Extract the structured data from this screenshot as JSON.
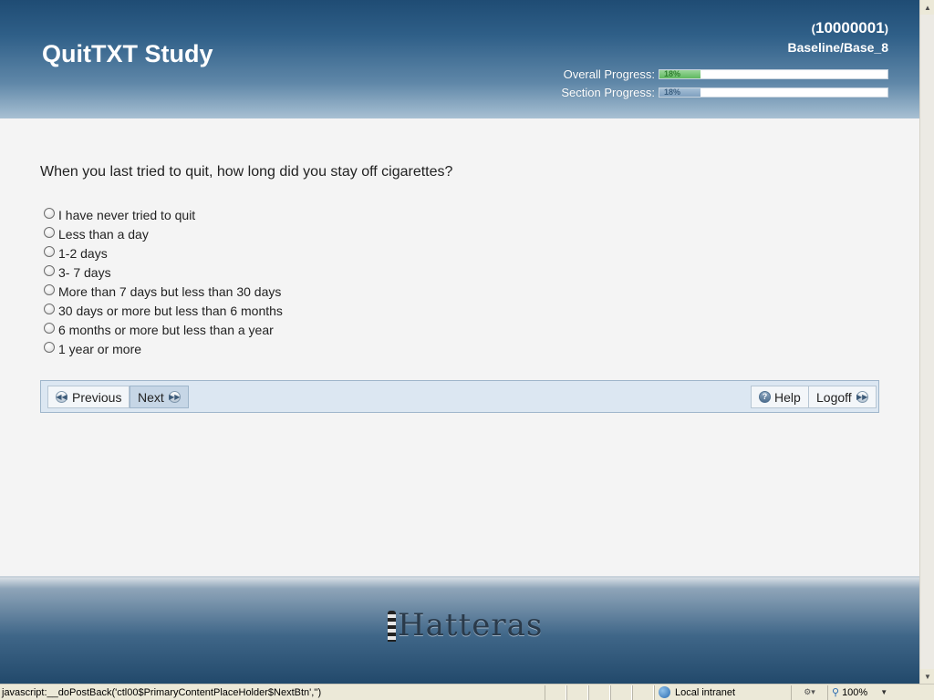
{
  "header": {
    "title": "QuitTXT Study",
    "participant_id": "10000001",
    "section_path": "Baseline/Base_8",
    "overall_progress": {
      "label": "Overall Progress:",
      "text": "18%",
      "value": 0.18
    },
    "section_progress": {
      "label": "Section Progress:",
      "text": "18%",
      "value": 0.18
    }
  },
  "question": {
    "text": "When you last tried to quit, how long did you stay off cigarettes?",
    "options": [
      "I have never tried to quit",
      "Less than a day",
      "1-2 days",
      "3- 7 days",
      "More than 7 days but less than 30 days",
      "30 days or more but less than 6 months",
      "6 months or more but less than a year",
      "1 year or more"
    ]
  },
  "nav": {
    "previous_label": "Previous",
    "next_label": "Next",
    "help_label": "Help",
    "logoff_label": "Logoff"
  },
  "footer": {
    "logo_text": "Hatteras"
  },
  "statusbar": {
    "status_text": "javascript:__doPostBack('ctl00$PrimaryContentPlaceHolder$NextBtn','')",
    "zone_text": "Local intranet",
    "zoom_text": "100%"
  },
  "colors": {
    "header_top": "#1f4c74",
    "overall_fill": "#5fb85f",
    "section_fill": "#7fa0bf",
    "navbar_bg": "#dce7f2"
  }
}
